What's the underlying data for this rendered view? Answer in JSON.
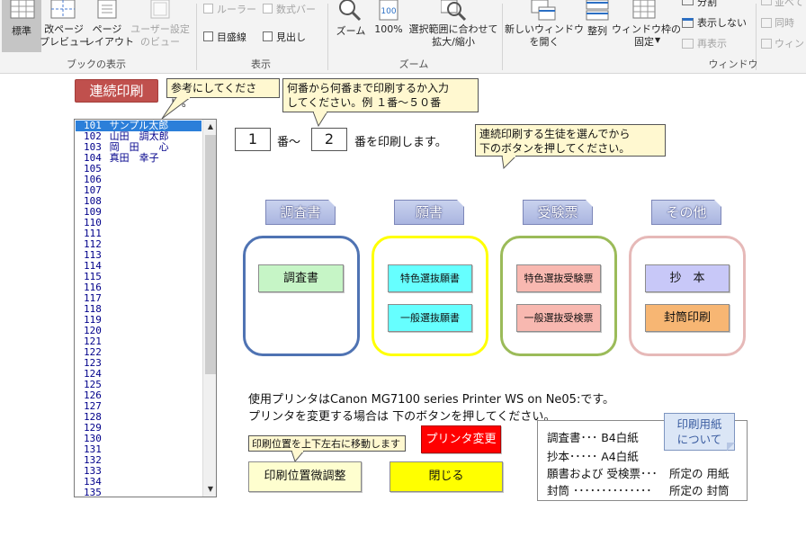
{
  "ribbon": {
    "view_group": {
      "label": "ブックの表示",
      "buttons": [
        {
          "label": "標準"
        },
        {
          "label": "改ページ\nプレビュー"
        },
        {
          "label": "ページ\nレイアウト"
        },
        {
          "label": "ユーザー設定\nのビュー"
        }
      ]
    },
    "show_group": {
      "label": "表示",
      "ruler": "ルーラー",
      "formula_bar": "数式バー",
      "gridlines": "目盛線",
      "headings": "見出し"
    },
    "zoom_group": {
      "label": "ズーム",
      "zoom": "ズーム",
      "zoom100": "100%",
      "fit_selection": "選択範囲に合わせて\n拡大/縮小"
    },
    "window_group": {
      "label": "ウィンドウ",
      "new_window": "新しいウィンドウ\nを開く",
      "arrange": "整列",
      "freeze": "ウィンドウ枠の\n固定",
      "split": "分割",
      "hide": "表示しない",
      "unhide": "再表示",
      "side_by_side": "並べて",
      "sync_scroll": "同時",
      "reset_pos": "ウィンド"
    }
  },
  "sheet": {
    "title": "連続印刷",
    "callout_reference": "参考にしてください。",
    "callout_range": "何番から何番まで印刷するか入力\nしてください。例 １番～５０番",
    "callout_select": "連続印刷する生徒を選んでから\n下のボタンを押してください。",
    "range_from": "1",
    "range_from_suffix": "番～",
    "range_to": "2",
    "range_to_suffix": "番を印刷します。",
    "students": [
      {
        "no": "101",
        "name": "サンプル太郎"
      },
      {
        "no": "102",
        "name": "山田　調太郎"
      },
      {
        "no": "103",
        "name": "岡　田　　心"
      },
      {
        "no": "104",
        "name": "真田　幸子"
      },
      {
        "no": "105",
        "name": ""
      },
      {
        "no": "106",
        "name": ""
      },
      {
        "no": "107",
        "name": ""
      },
      {
        "no": "108",
        "name": ""
      },
      {
        "no": "109",
        "name": ""
      },
      {
        "no": "110",
        "name": ""
      },
      {
        "no": "111",
        "name": ""
      },
      {
        "no": "112",
        "name": ""
      },
      {
        "no": "113",
        "name": ""
      },
      {
        "no": "114",
        "name": ""
      },
      {
        "no": "115",
        "name": ""
      },
      {
        "no": "116",
        "name": ""
      },
      {
        "no": "117",
        "name": ""
      },
      {
        "no": "118",
        "name": ""
      },
      {
        "no": "119",
        "name": ""
      },
      {
        "no": "120",
        "name": ""
      },
      {
        "no": "121",
        "name": ""
      },
      {
        "no": "122",
        "name": ""
      },
      {
        "no": "123",
        "name": ""
      },
      {
        "no": "124",
        "name": ""
      },
      {
        "no": "125",
        "name": ""
      },
      {
        "no": "126",
        "name": ""
      },
      {
        "no": "127",
        "name": ""
      },
      {
        "no": "128",
        "name": ""
      },
      {
        "no": "129",
        "name": ""
      },
      {
        "no": "130",
        "name": ""
      },
      {
        "no": "131",
        "name": ""
      },
      {
        "no": "132",
        "name": ""
      },
      {
        "no": "133",
        "name": ""
      },
      {
        "no": "134",
        "name": ""
      },
      {
        "no": "135",
        "name": ""
      }
    ],
    "categories": {
      "survey": "調査書",
      "application": "願書",
      "exam_ticket": "受験票",
      "other": "その他"
    },
    "buttons": {
      "survey_print": "調査書",
      "special_application": "特色選抜願書",
      "general_application": "一般選抜願書",
      "special_ticket": "特色選抜受験票",
      "general_ticket": "一般選抜受検票",
      "abstract": "抄　本",
      "envelope": "封筒印刷",
      "printer_change": "プリンタ変更",
      "position_adjust": "印刷位置微調整",
      "close": "閉じる"
    },
    "printer_info_1": "使用プリンタはCanon MG7100 series Printer WS on Ne05:です。",
    "printer_info_2": "プリンタを変更する場合は 下のボタンを押してください。",
    "callout_position": "印刷位置を上下左右に移動します",
    "paper_callout": "印刷用紙\nについて",
    "paper_rows": [
      {
        "left": "調査書･･･ B4白紙",
        "right": ""
      },
      {
        "left": "抄本･････ A4白紙",
        "right": ""
      },
      {
        "left": "願書および 受検票･･･",
        "right": "所定の 用紙"
      },
      {
        "left": "封筒 ･･････････････",
        "right": "所定の 封筒"
      }
    ]
  },
  "colors": {
    "title_bg": "#c0504d",
    "survey_border": "#4f73b3",
    "application_border": "#ffff00",
    "ticket_border": "#9bbb59",
    "other_border": "#e6b9b8",
    "green_btn": "#c6f5c6",
    "cyan_btn": "#66ffff",
    "pink_btn": "#f8b8b0",
    "lavender_btn": "#c8c8f8",
    "orange_btn": "#f7b673",
    "red_btn": "#ff0000",
    "yellow_btn": "#ffff00",
    "light_yellow_btn": "#fefecf"
  }
}
